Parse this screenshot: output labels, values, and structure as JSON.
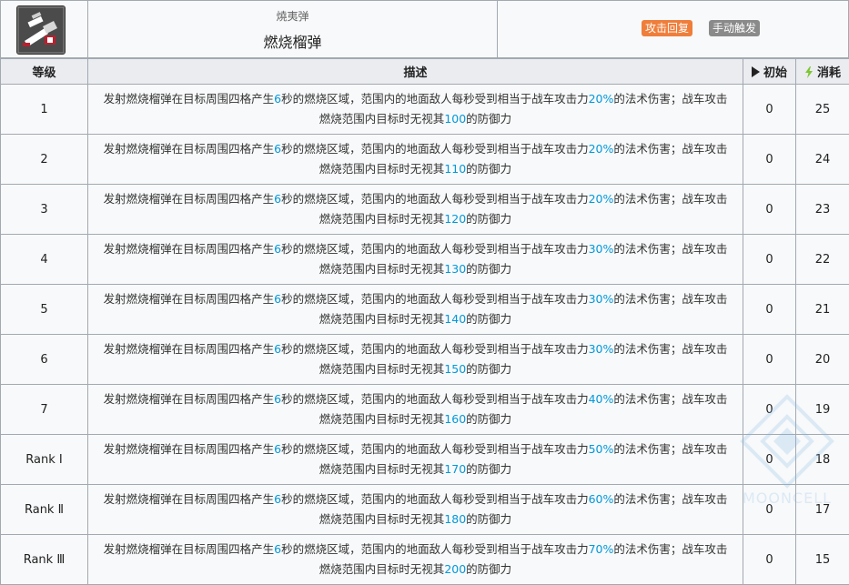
{
  "skill": {
    "icon": "incendiary-grenade-icon",
    "type_label": "燒夷弹",
    "name": "燃烧榴弹",
    "tags": [
      {
        "label": "攻击回复",
        "color": "#ef7e3b"
      },
      {
        "label": "手动触发",
        "color": "#8a8a8a"
      }
    ]
  },
  "table": {
    "headers": {
      "level": "等级",
      "description": "描述",
      "initial": "初始",
      "cost": "消耗"
    },
    "rows": [
      {
        "level": "1",
        "pre": "发射燃烧榴弹在目标周围四格产生",
        "dur": "6",
        "mid": "秒的燃烧区域，范围内的地面敌人每秒受到相当于战车攻击力",
        "pct": "20%",
        "post": "的法术伤害；战车攻击燃烧范围内目标时无视其",
        "ign": "100",
        "end": "的防御力",
        "initial": "0",
        "cost": "25"
      },
      {
        "level": "2",
        "pre": "发射燃烧榴弹在目标周围四格产生",
        "dur": "6",
        "mid": "秒的燃烧区域，范围内的地面敌人每秒受到相当于战车攻击力",
        "pct": "20%",
        "post": "的法术伤害；战车攻击燃烧范围内目标时无视其",
        "ign": "110",
        "end": "的防御力",
        "initial": "0",
        "cost": "24"
      },
      {
        "level": "3",
        "pre": "发射燃烧榴弹在目标周围四格产生",
        "dur": "6",
        "mid": "秒的燃烧区域，范围内的地面敌人每秒受到相当于战车攻击力",
        "pct": "20%",
        "post": "的法术伤害；战车攻击燃烧范围内目标时无视其",
        "ign": "120",
        "end": "的防御力",
        "initial": "0",
        "cost": "23"
      },
      {
        "level": "4",
        "pre": "发射燃烧榴弹在目标周围四格产生",
        "dur": "6",
        "mid": "秒的燃烧区域，范围内的地面敌人每秒受到相当于战车攻击力",
        "pct": "30%",
        "post": "的法术伤害；战车攻击燃烧范围内目标时无视其",
        "ign": "130",
        "end": "的防御力",
        "initial": "0",
        "cost": "22"
      },
      {
        "level": "5",
        "pre": "发射燃烧榴弹在目标周围四格产生",
        "dur": "6",
        "mid": "秒的燃烧区域，范围内的地面敌人每秒受到相当于战车攻击力",
        "pct": "30%",
        "post": "的法术伤害；战车攻击燃烧范围内目标时无视其",
        "ign": "140",
        "end": "的防御力",
        "initial": "0",
        "cost": "21"
      },
      {
        "level": "6",
        "pre": "发射燃烧榴弹在目标周围四格产生",
        "dur": "6",
        "mid": "秒的燃烧区域，范围内的地面敌人每秒受到相当于战车攻击力",
        "pct": "30%",
        "post": "的法术伤害；战车攻击燃烧范围内目标时无视其",
        "ign": "150",
        "end": "的防御力",
        "initial": "0",
        "cost": "20"
      },
      {
        "level": "7",
        "pre": "发射燃烧榴弹在目标周围四格产生",
        "dur": "6",
        "mid": "秒的燃烧区域，范围内的地面敌人每秒受到相当于战车攻击力",
        "pct": "40%",
        "post": "的法术伤害；战车攻击燃烧范围内目标时无视其",
        "ign": "160",
        "end": "的防御力",
        "initial": "0",
        "cost": "19"
      },
      {
        "level": "Rank Ⅰ",
        "pre": "发射燃烧榴弹在目标周围四格产生",
        "dur": "6",
        "mid": "秒的燃烧区域，范围内的地面敌人每秒受到相当于战车攻击力",
        "pct": "50%",
        "post": "的法术伤害；战车攻击燃烧范围内目标时无视其",
        "ign": "170",
        "end": "的防御力",
        "initial": "0",
        "cost": "18"
      },
      {
        "level": "Rank Ⅱ",
        "pre": "发射燃烧榴弹在目标周围四格产生",
        "dur": "6",
        "mid": "秒的燃烧区域，范围内的地面敌人每秒受到相当于战车攻击力",
        "pct": "60%",
        "post": "的法术伤害；战车攻击燃烧范围内目标时无视其",
        "ign": "180",
        "end": "的防御力",
        "initial": "0",
        "cost": "17"
      },
      {
        "level": "Rank Ⅲ",
        "pre": "发射燃烧榴弹在目标周围四格产生",
        "dur": "6",
        "mid": "秒的燃烧区域，范围内的地面敌人每秒受到相当于战车攻击力",
        "pct": "70%",
        "post": "的法术伤害；战车攻击燃烧范围内目标时无视其",
        "ign": "200",
        "end": "的防御力",
        "initial": "0",
        "cost": "15"
      }
    ]
  },
  "watermark": {
    "text": "MOONCELL",
    "icon": "mooncell-logo-icon"
  },
  "colors": {
    "highlight": "#0098dc",
    "header_bg": "#eaecf0",
    "cell_bg": "#f8f9fa",
    "border": "#a2a9b1",
    "bolt": "#7cc631"
  }
}
